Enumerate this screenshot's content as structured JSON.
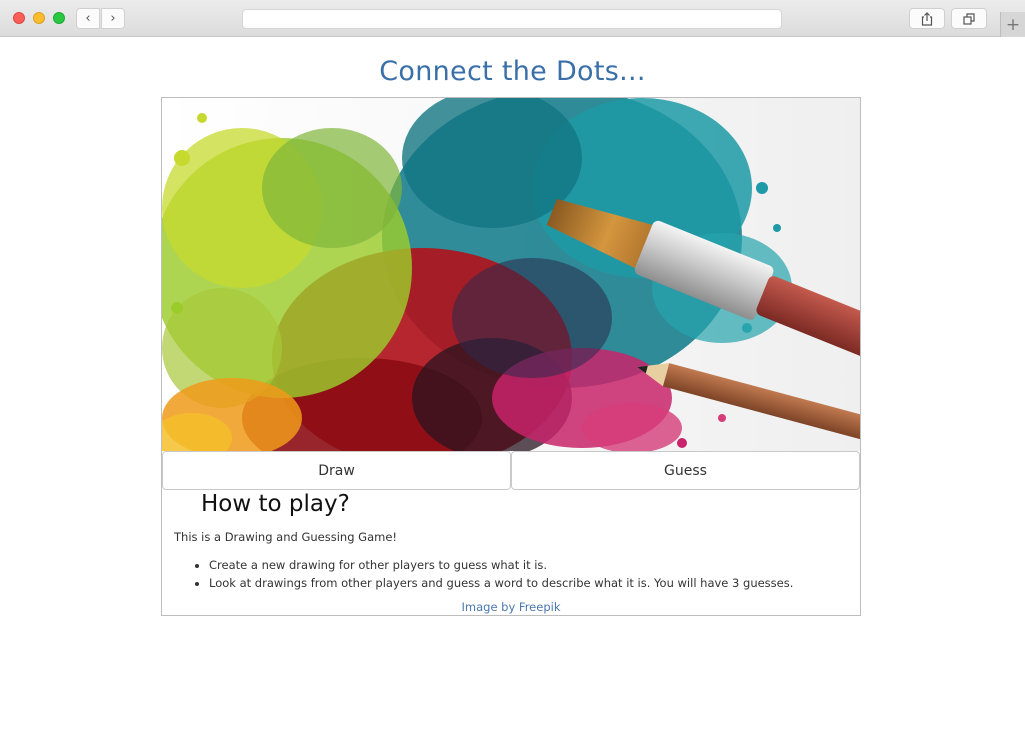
{
  "browser": {
    "back_icon": "chevron-left-icon",
    "forward_icon": "chevron-right-icon",
    "back_glyph": "‹",
    "forward_glyph": "›",
    "url": "",
    "share_icon": "share-icon",
    "tabs_icon": "tabs-overview-icon",
    "new_tab_glyph": "+"
  },
  "page": {
    "title": "Connect the Dots...",
    "hero_image": "paint-splash-brush-pencil",
    "buttons": {
      "draw": "Draw",
      "guess": "Guess"
    },
    "how_to_play": {
      "heading": "How to play?",
      "intro": "This is a Drawing and Guessing Game!",
      "rules": [
        "Create a new drawing for other players to guess what it is.",
        "Look at drawings from other players and guess a word to describe what it is. You will have 3 guesses."
      ]
    },
    "credit": "Image by Freepik"
  },
  "colors": {
    "title": "#3a6fa8",
    "link": "#4a78b0",
    "teal": "#1a8d99",
    "lime": "#9ccc2c",
    "crimson": "#b0141c",
    "magenta": "#c8236a"
  }
}
